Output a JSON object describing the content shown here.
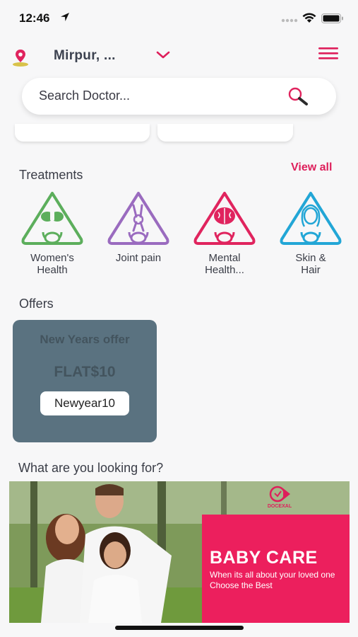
{
  "status_bar": {
    "time": "12:46"
  },
  "header": {
    "location": "Mirpur, ..."
  },
  "search": {
    "placeholder": "Search Doctor..."
  },
  "treatments": {
    "title": "Treatments",
    "view_all": "View all",
    "items": [
      {
        "label_line1": "Women's",
        "label_line2": "Health",
        "color": "#5cae5c",
        "icon": "women-health-icon"
      },
      {
        "label_line1": "Joint pain",
        "label_line2": "",
        "color": "#9a6bbf",
        "icon": "joint-pain-icon"
      },
      {
        "label_line1": "Mental",
        "label_line2": "Health...",
        "color": "#e0245e",
        "icon": "mental-health-icon"
      },
      {
        "label_line1": "Skin &",
        "label_line2": "Hair",
        "color": "#22a6d6",
        "icon": "skin-hair-icon"
      }
    ]
  },
  "offers": {
    "title": "Offers",
    "card": {
      "title": "New Years offer",
      "amount": "FLAT$10",
      "code": "Newyear10",
      "bg": "#5a7280"
    }
  },
  "looking_for": {
    "title": "What are you looking for?",
    "banner": {
      "brand": "DOCEXAL",
      "title": "BABY CARE",
      "subtitle": "When its all about your loved one Choose the Best",
      "accent": "#ec1f5d"
    }
  }
}
